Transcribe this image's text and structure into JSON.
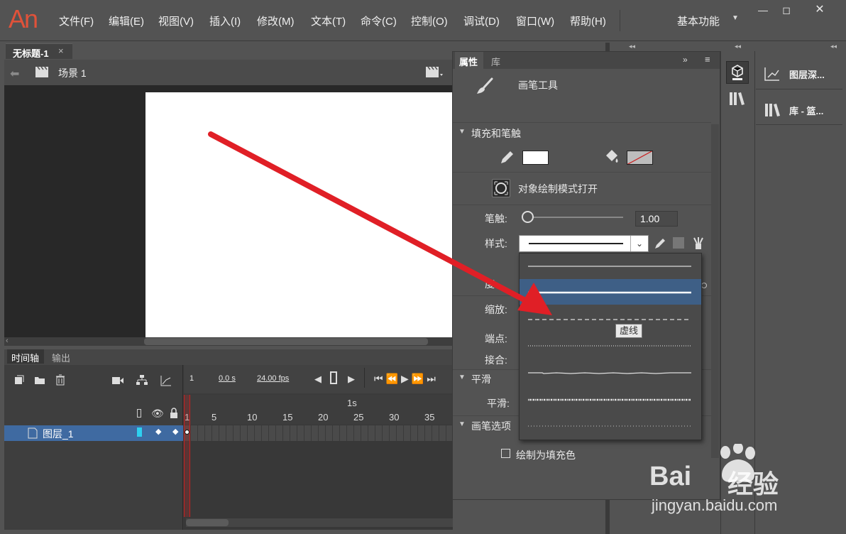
{
  "app": {
    "logo": "An"
  },
  "menu": {
    "items": [
      "文件(F)",
      "编辑(E)",
      "视图(V)",
      "插入(I)",
      "修改(M)",
      "文本(T)",
      "命令(C)",
      "控制(O)",
      "调试(D)",
      "窗口(W)",
      "帮助(H)"
    ],
    "workspace": "基本功能"
  },
  "document": {
    "tab_title": "无标题-1",
    "close_glyph": "×",
    "scene": "场景 1"
  },
  "timeline": {
    "tabs": {
      "timeline": "时间轴",
      "output": "输出"
    },
    "frame": "1",
    "time": "0.0 s",
    "fps": "24.00 fps",
    "ruler_second": "1s",
    "ticks": [
      "1",
      "5",
      "10",
      "15",
      "20",
      "25",
      "30",
      "35"
    ],
    "layer_name": "图层_1"
  },
  "properties": {
    "tabs": {
      "props": "属性",
      "library": "库"
    },
    "tool_name": "画笔工具",
    "section_fill_stroke": "填充和笔触",
    "object_draw_mode": "对象绘制模式打开",
    "stroke_label": "笔触:",
    "stroke_value": "1.00",
    "style_label": "样式:",
    "width_label_partial": "度:",
    "scale_label": "缩放:",
    "cap_label": "端点:",
    "join_label": "接合:",
    "section_smooth": "平滑",
    "smooth_label": "平滑:",
    "section_brush_options": "画笔选项",
    "draw_as_fill": "绘制为填充色",
    "style_options": [
      "极细线",
      "实线",
      "虚线",
      "点状线",
      "锯齿线",
      "点刻线",
      "斑马线"
    ],
    "selected_style_index": 1,
    "tooltip": "虚线"
  },
  "dock": {
    "items": [
      {
        "label": "图层深...",
        "icon": "layer-depth-icon"
      },
      {
        "label": "库 - 篮...",
        "icon": "library-icon"
      }
    ]
  },
  "watermark": {
    "brand": "Bai",
    "brand_cn": "经验",
    "url": "jingyan.baidu.com"
  },
  "colors": {
    "accent_red": "#e0523a",
    "selection_blue": "#3f6aa1",
    "arrow_red": "#e01f26"
  }
}
